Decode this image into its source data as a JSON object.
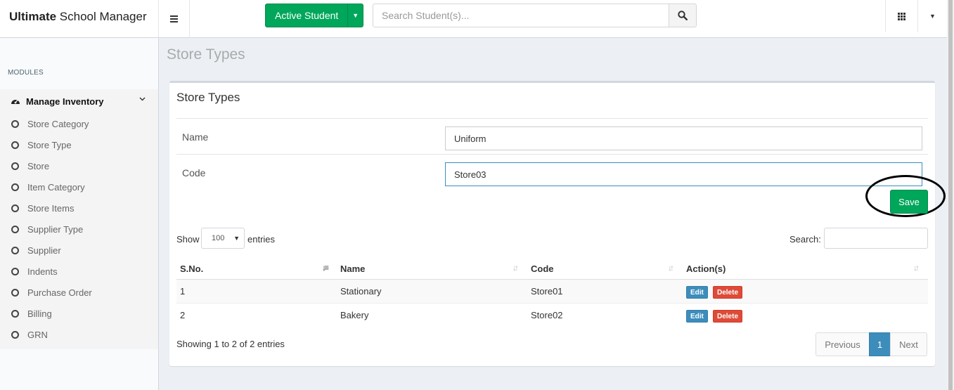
{
  "header": {
    "brand_bold": "Ultimate",
    "brand_rest": " School Manager",
    "active_student_label": "Active Student",
    "search_placeholder": "Search Student(s)..."
  },
  "sidebar": {
    "section_label": "MODULES",
    "parent_label": "Manage Inventory",
    "items": [
      {
        "label": "Store Category"
      },
      {
        "label": "Store Type"
      },
      {
        "label": "Store"
      },
      {
        "label": "Item Category"
      },
      {
        "label": "Store Items"
      },
      {
        "label": "Supplier Type"
      },
      {
        "label": "Supplier"
      },
      {
        "label": "Indents"
      },
      {
        "label": "Purchase Order"
      },
      {
        "label": "Billing"
      },
      {
        "label": "GRN"
      }
    ]
  },
  "page": {
    "title": "Store Types",
    "box_title": "Store Types"
  },
  "form": {
    "name_label": "Name",
    "name_value": "Uniform",
    "code_label": "Code",
    "code_value": "Store03",
    "save_label": "Save"
  },
  "table_controls": {
    "show_label": "Show",
    "page_length": "100",
    "entries_label": "entries",
    "search_label": "Search:"
  },
  "table": {
    "columns": [
      "S.No.",
      "Name",
      "Code",
      "Action(s)"
    ],
    "rows": [
      {
        "sno": "1",
        "name": "Stationary",
        "code": "Store01",
        "edit": "Edit",
        "delete": "Delete"
      },
      {
        "sno": "2",
        "name": "Bakery",
        "code": "Store02",
        "edit": "Edit",
        "delete": "Delete"
      }
    ]
  },
  "pagination": {
    "info": "Showing 1 to 2 of 2 entries",
    "previous": "Previous",
    "current": "1",
    "next": "Next"
  },
  "colors": {
    "success": "#00a65a",
    "primary": "#3c8dbc",
    "danger": "#dd4b39"
  }
}
